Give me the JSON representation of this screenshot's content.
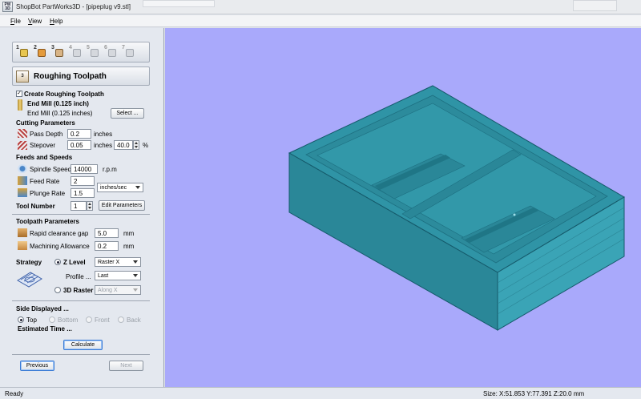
{
  "window": {
    "app_icon_text": "PW 3D",
    "title": "ShopBot PartWorks3D - [pipeplug v9.stl]"
  },
  "menu": {
    "items": [
      "File",
      "View",
      "Help"
    ]
  },
  "toolbar": {
    "steps": [
      "1",
      "2",
      "3",
      "4",
      "5",
      "6",
      "7"
    ]
  },
  "section": {
    "number": "3",
    "title": "Roughing Toolpath"
  },
  "create_roughing": {
    "label": "Create Roughing Toolpath",
    "checked": true
  },
  "tool": {
    "name_bold": "End Mill (0.125 inch)",
    "name": "End Mill (0.125 inches)",
    "select_label": "Select ..."
  },
  "cutting": {
    "heading": "Cutting Parameters",
    "pass_depth_label": "Pass Depth",
    "pass_depth_value": "0.2",
    "pass_depth_unit": "inches",
    "stepover_label": "Stepover",
    "stepover_value": "0.05",
    "stepover_unit": "inches",
    "stepover_percent": "40.0",
    "percent_sign": "%"
  },
  "feeds": {
    "heading": "Feeds and Speeds",
    "spindle_label": "Spindle Speed",
    "spindle_value": "14000",
    "spindle_unit": "r.p.m",
    "feed_label": "Feed Rate",
    "feed_value": "2",
    "plunge_label": "Plunge Rate",
    "plunge_value": "1.5",
    "rate_unit": "inches/sec",
    "tool_number_label": "Tool Number",
    "tool_number_value": "1",
    "edit_params_label": "Edit Parameters"
  },
  "toolpath_params": {
    "heading": "Toolpath Parameters",
    "rapid_label": "Rapid clearance gap",
    "rapid_value": "5.0",
    "rapid_unit": "mm",
    "allowance_label": "Machining Allowance",
    "allowance_value": "0.2",
    "allowance_unit": "mm"
  },
  "strategy": {
    "label": "Strategy",
    "zlevel_label": "Z Level",
    "zlevel_option": "Raster X",
    "profile_label": "Profile ...",
    "profile_option": "Last",
    "raster3d_label": "3D Raster",
    "raster3d_option": "Along X"
  },
  "side": {
    "heading": "Side Displayed ...",
    "options": [
      "Top",
      "Bottom",
      "Front",
      "Back"
    ],
    "selected": "Top",
    "estimated_label": "Estimated Time ..."
  },
  "actions": {
    "calculate": "Calculate",
    "previous": "Previous",
    "next": "Next"
  },
  "status": {
    "left": "Ready",
    "right": "Size: X:51.853 Y:77.391 Z:20.0 mm"
  },
  "colors": {
    "viewport_bg": "#a9a9fb",
    "model": "#2f94a6",
    "model_dark": "#1d6f80"
  }
}
